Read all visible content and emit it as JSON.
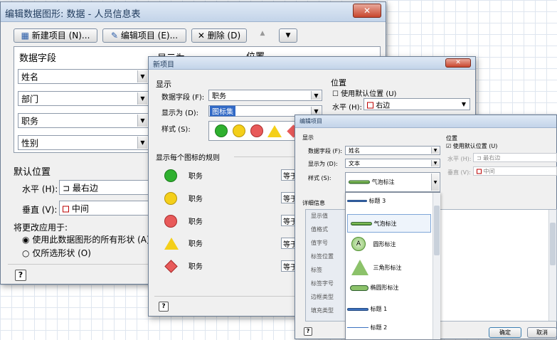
{
  "dlg1": {
    "title": "编辑数据图形: 数据 - 人员信息表",
    "new_item": "新建项目 (N)...",
    "edit_item": "编辑项目 (E)...",
    "delete": "删除 (D)",
    "col_field": "数据字段",
    "col_display": "显示为",
    "col_position": "位置",
    "rows": [
      "姓名",
      "部门",
      "职务",
      "性别"
    ],
    "default_pos": "默认位置",
    "horizontal_label": "水平 (H):",
    "horizontal_value": "最右边",
    "vertical_label": "垂直 (V):",
    "vertical_value": "中间",
    "apply_label": "将更改应用于:",
    "apply_all": "使用此数据图形的所有形状 (A)",
    "apply_selected": "仅所选形状 (O)"
  },
  "dlg2": {
    "title": "新项目",
    "display_header": "显示",
    "field_label": "数据字段 (F):",
    "field_value": "职务",
    "display_label": "显示为 (D):",
    "display_value": "图标集",
    "style_label": "样式 (S):",
    "position_header": "位置",
    "use_default": "使用默认位置 (U)",
    "horizontal_label": "水平 (H):",
    "horizontal_value": "右边",
    "rules_header": "显示每个图标的规则",
    "rules": [
      {
        "icon": "green-circle",
        "field": "职务",
        "op": "等于"
      },
      {
        "icon": "yellow-circle",
        "field": "职务",
        "op": "等于"
      },
      {
        "icon": "red-circle",
        "field": "职务",
        "op": "等于"
      },
      {
        "icon": "yellow-triangle",
        "field": "职务",
        "op": "等于"
      },
      {
        "icon": "red-diamond",
        "field": "职务",
        "op": "等于"
      }
    ],
    "colors": {
      "green": "#2fb02f",
      "yellow": "#f4cf1a",
      "red": "#e85a5a"
    }
  },
  "dlg3": {
    "title": "编辑项目",
    "display_header": "显示",
    "field_label": "数据字段 (F):",
    "field_value": "姓名",
    "display_label": "显示为 (D):",
    "display_value": "文本",
    "style_label": "样式 (S):",
    "style_value": "气泡标注",
    "position_header": "位置",
    "use_default": "使用默认位置 (U)",
    "horizontal_label": "水平 (H):",
    "horizontal_value": "最右边",
    "vertical_label": "垂直 (V):",
    "vertical_value": "中间",
    "details_header": "详细信息",
    "details": [
      "显示值",
      "值格式",
      "值字号",
      "标签位置",
      "标签",
      "标签字号",
      "边框类型",
      "填充类型"
    ],
    "style_options": [
      "标题 3",
      "气泡标注",
      "圆形标注",
      "三角形标注",
      "椭圆形标注",
      "标题 1",
      "标题 2"
    ],
    "ok": "确定",
    "cancel": "取消"
  }
}
